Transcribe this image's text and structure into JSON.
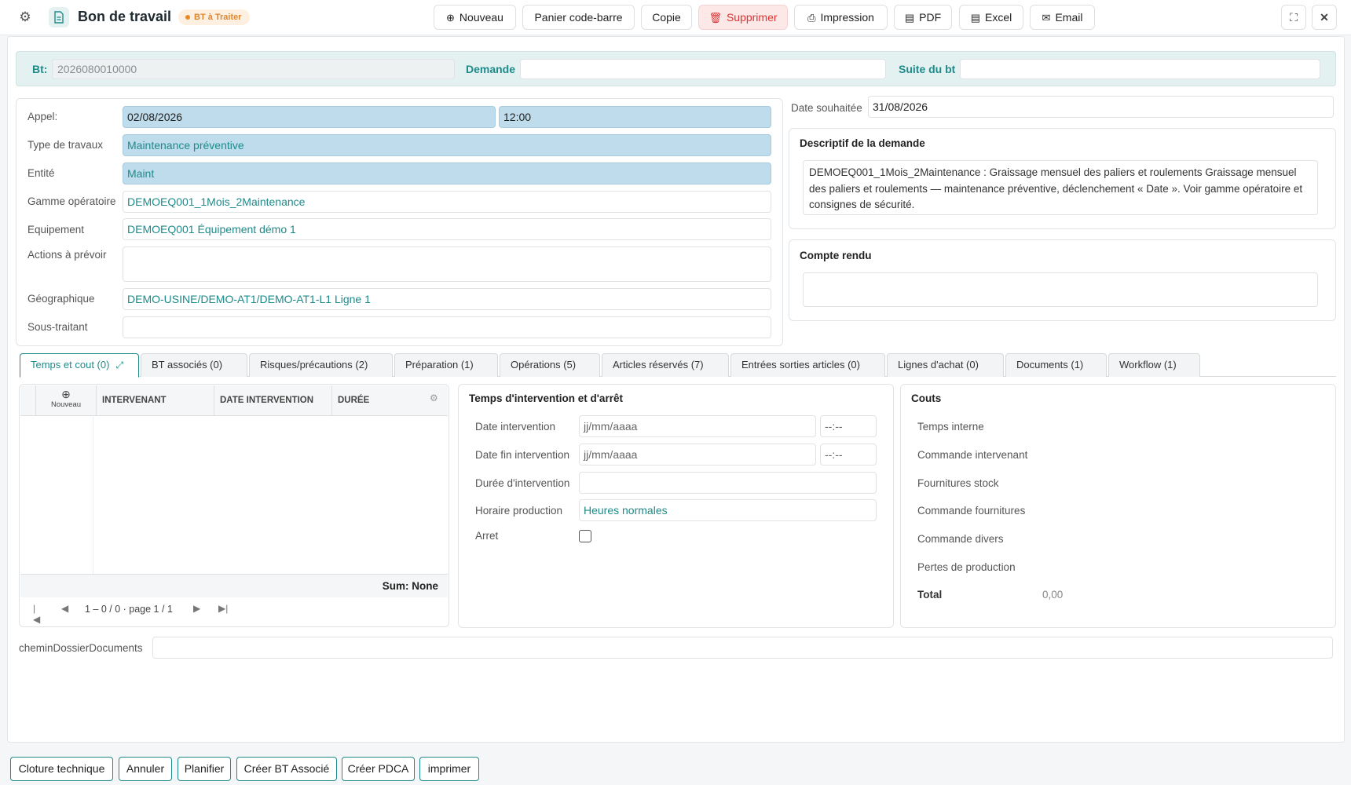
{
  "header": {
    "title": "Bon de travail",
    "status_badge": "BT à Traiter",
    "buttons": {
      "nouveau": "Nouveau",
      "panier": "Panier code-barre",
      "copie": "Copie",
      "supprimer": "Supprimer",
      "impression": "Impression",
      "pdf": "PDF",
      "excel": "Excel",
      "email": "Email"
    }
  },
  "band": {
    "bt_label": "Bt:",
    "bt_value": "2026080010000",
    "demande_label": "Demande",
    "demande_value": "",
    "suite_label": "Suite du bt",
    "suite_value": ""
  },
  "form": {
    "appel_label": "Appel:",
    "appel_date": "02/08/2026",
    "appel_time": "12:00",
    "type_label": "Type de travaux",
    "type_value": "Maintenance préventive",
    "entite_label": "Entité",
    "entite_value": "Maint",
    "gamme_label": "Gamme opératoire",
    "gamme_value": "DEMOEQ001_1Mois_2Maintenance",
    "equipement_label": "Equipement",
    "equipement_value": "DEMOEQ001 Équipement démo 1",
    "actions_label": "Actions à prévoir",
    "actions_value": "",
    "geo_label": "Géographique",
    "geo_value": "DEMO-USINE/DEMO-AT1/DEMO-AT1-L1 Ligne 1",
    "sous_label": "Sous-traitant",
    "sous_value": ""
  },
  "right": {
    "date_souhaitee_label": "Date souhaitée",
    "date_souhaitee_value": "31/08/2026",
    "descriptif_title": "Descriptif de la demande",
    "descriptif_text": "DEMOEQ001_1Mois_2Maintenance : Graissage mensuel des paliers et roulements Graissage mensuel des paliers et roulements — maintenance préventive, déclenchement « Date ». Voir gamme opératoire et consignes de sécurité.",
    "compte_rendu_title": "Compte rendu",
    "compte_rendu_text": ""
  },
  "tabs": [
    {
      "label": "Temps et cout (0)"
    },
    {
      "label": "BT associés (0)"
    },
    {
      "label": "Risques/précautions (2)"
    },
    {
      "label": "Préparation (1)"
    },
    {
      "label": "Opérations (5)"
    },
    {
      "label": "Articles réservés (7)"
    },
    {
      "label": "Entrées sorties articles (0)"
    },
    {
      "label": "Lignes d'achat (0)"
    },
    {
      "label": "Documents (1)"
    },
    {
      "label": "Workflow (1)"
    }
  ],
  "grid": {
    "new_label": "Nouveau",
    "columns": [
      "INTERVENANT",
      "DATE INTERVENTION",
      "DURÉE"
    ],
    "rows": [],
    "sum_label": "Sum: None",
    "pager_text": "1 – 0 / 0 · page 1 / 1"
  },
  "temps": {
    "title": "Temps d'intervention et d'arrêt",
    "date_intervention_label": "Date intervention",
    "date_fin_label": "Date fin intervention",
    "date_placeholder": "jj/mm/aaaa",
    "time_placeholder": "--:--",
    "duree_label": "Durée d'intervention",
    "duree_value": "",
    "horaire_label": "Horaire production",
    "horaire_value": "Heures normales",
    "arret_label": "Arret",
    "arret_checked": false
  },
  "couts": {
    "title": "Couts",
    "temps_interne": "Temps interne",
    "commande_intervenant": "Commande intervenant",
    "fournitures_stock": "Fournitures stock",
    "commande_fournitures": "Commande fournitures",
    "commande_divers": "Commande divers",
    "pertes_production": "Pertes de production",
    "total_label": "Total",
    "total_value": "0,00"
  },
  "chemin": {
    "label": "cheminDossierDocuments",
    "value": ""
  },
  "footer": {
    "cloture": "Cloture technique",
    "annuler": "Annuler",
    "planifier": "Planifier",
    "creer_bt": "Créer BT Associé",
    "creer_pdca": "Créer PDCA",
    "imprimer": "imprimer"
  },
  "colors": {
    "accent": "#1f8a8a",
    "required_field": "#bfdcec",
    "badge_bg": "#fdf0e1",
    "badge_text": "#e0872e",
    "danger_bg": "#fde8e8",
    "danger_text": "#dd3333"
  },
  "icons": [
    "gear-icon",
    "document-icon",
    "plus-circle-icon",
    "trash-icon",
    "printer-icon",
    "pdf-file-icon",
    "excel-file-icon",
    "mail-icon",
    "expand-icon",
    "close-icon",
    "external-link-icon",
    "settings-icon",
    "first-page-icon",
    "prev-page-icon",
    "next-page-icon",
    "last-page-icon"
  ]
}
